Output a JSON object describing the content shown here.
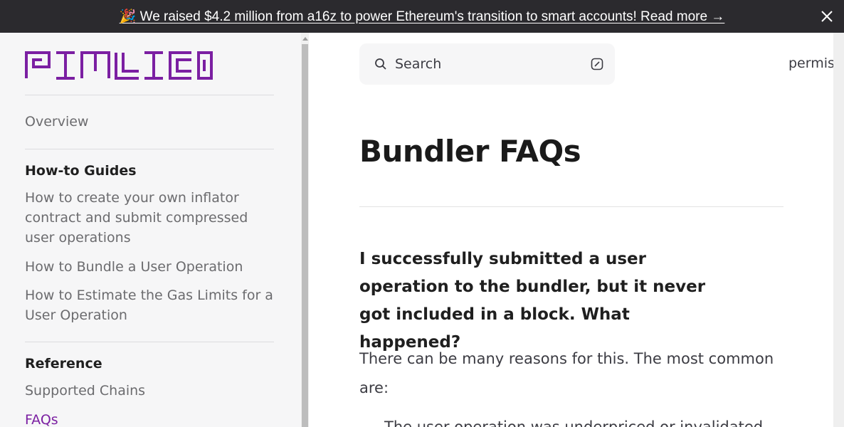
{
  "banner": {
    "text": "🎉 We raised $4.2 million from a16z to power Ethereum's transition to smart accounts! Read more →",
    "close_icon": "close-icon"
  },
  "brand": {
    "logo_text": "PIMLICO",
    "color": "#7b1fa2"
  },
  "sidebar": {
    "overview": "Overview",
    "sections": [
      {
        "heading": "How-to Guides",
        "items": [
          "How to create your own inflator contract and submit compressed user operations",
          "How to Bundle a User Operation",
          "How to Estimate the Gas Limits for a User Operation"
        ]
      },
      {
        "heading": "Reference",
        "items": [
          "Supported Chains",
          "FAQs"
        ]
      }
    ],
    "active_item": "FAQs"
  },
  "header": {
    "search_placeholder": "Search",
    "search_icon": "search-icon",
    "shortcut_icon": "slash-key-icon",
    "nav_partial": "permis"
  },
  "main": {
    "title": "Bundler FAQs",
    "question": "I successfully submitted a user operation to the bundler, but it never got included in a block. What happened?",
    "answer": "There can be many reasons for this. The most common are:",
    "cut_text": "The user operation was underpriced or invalidated"
  }
}
